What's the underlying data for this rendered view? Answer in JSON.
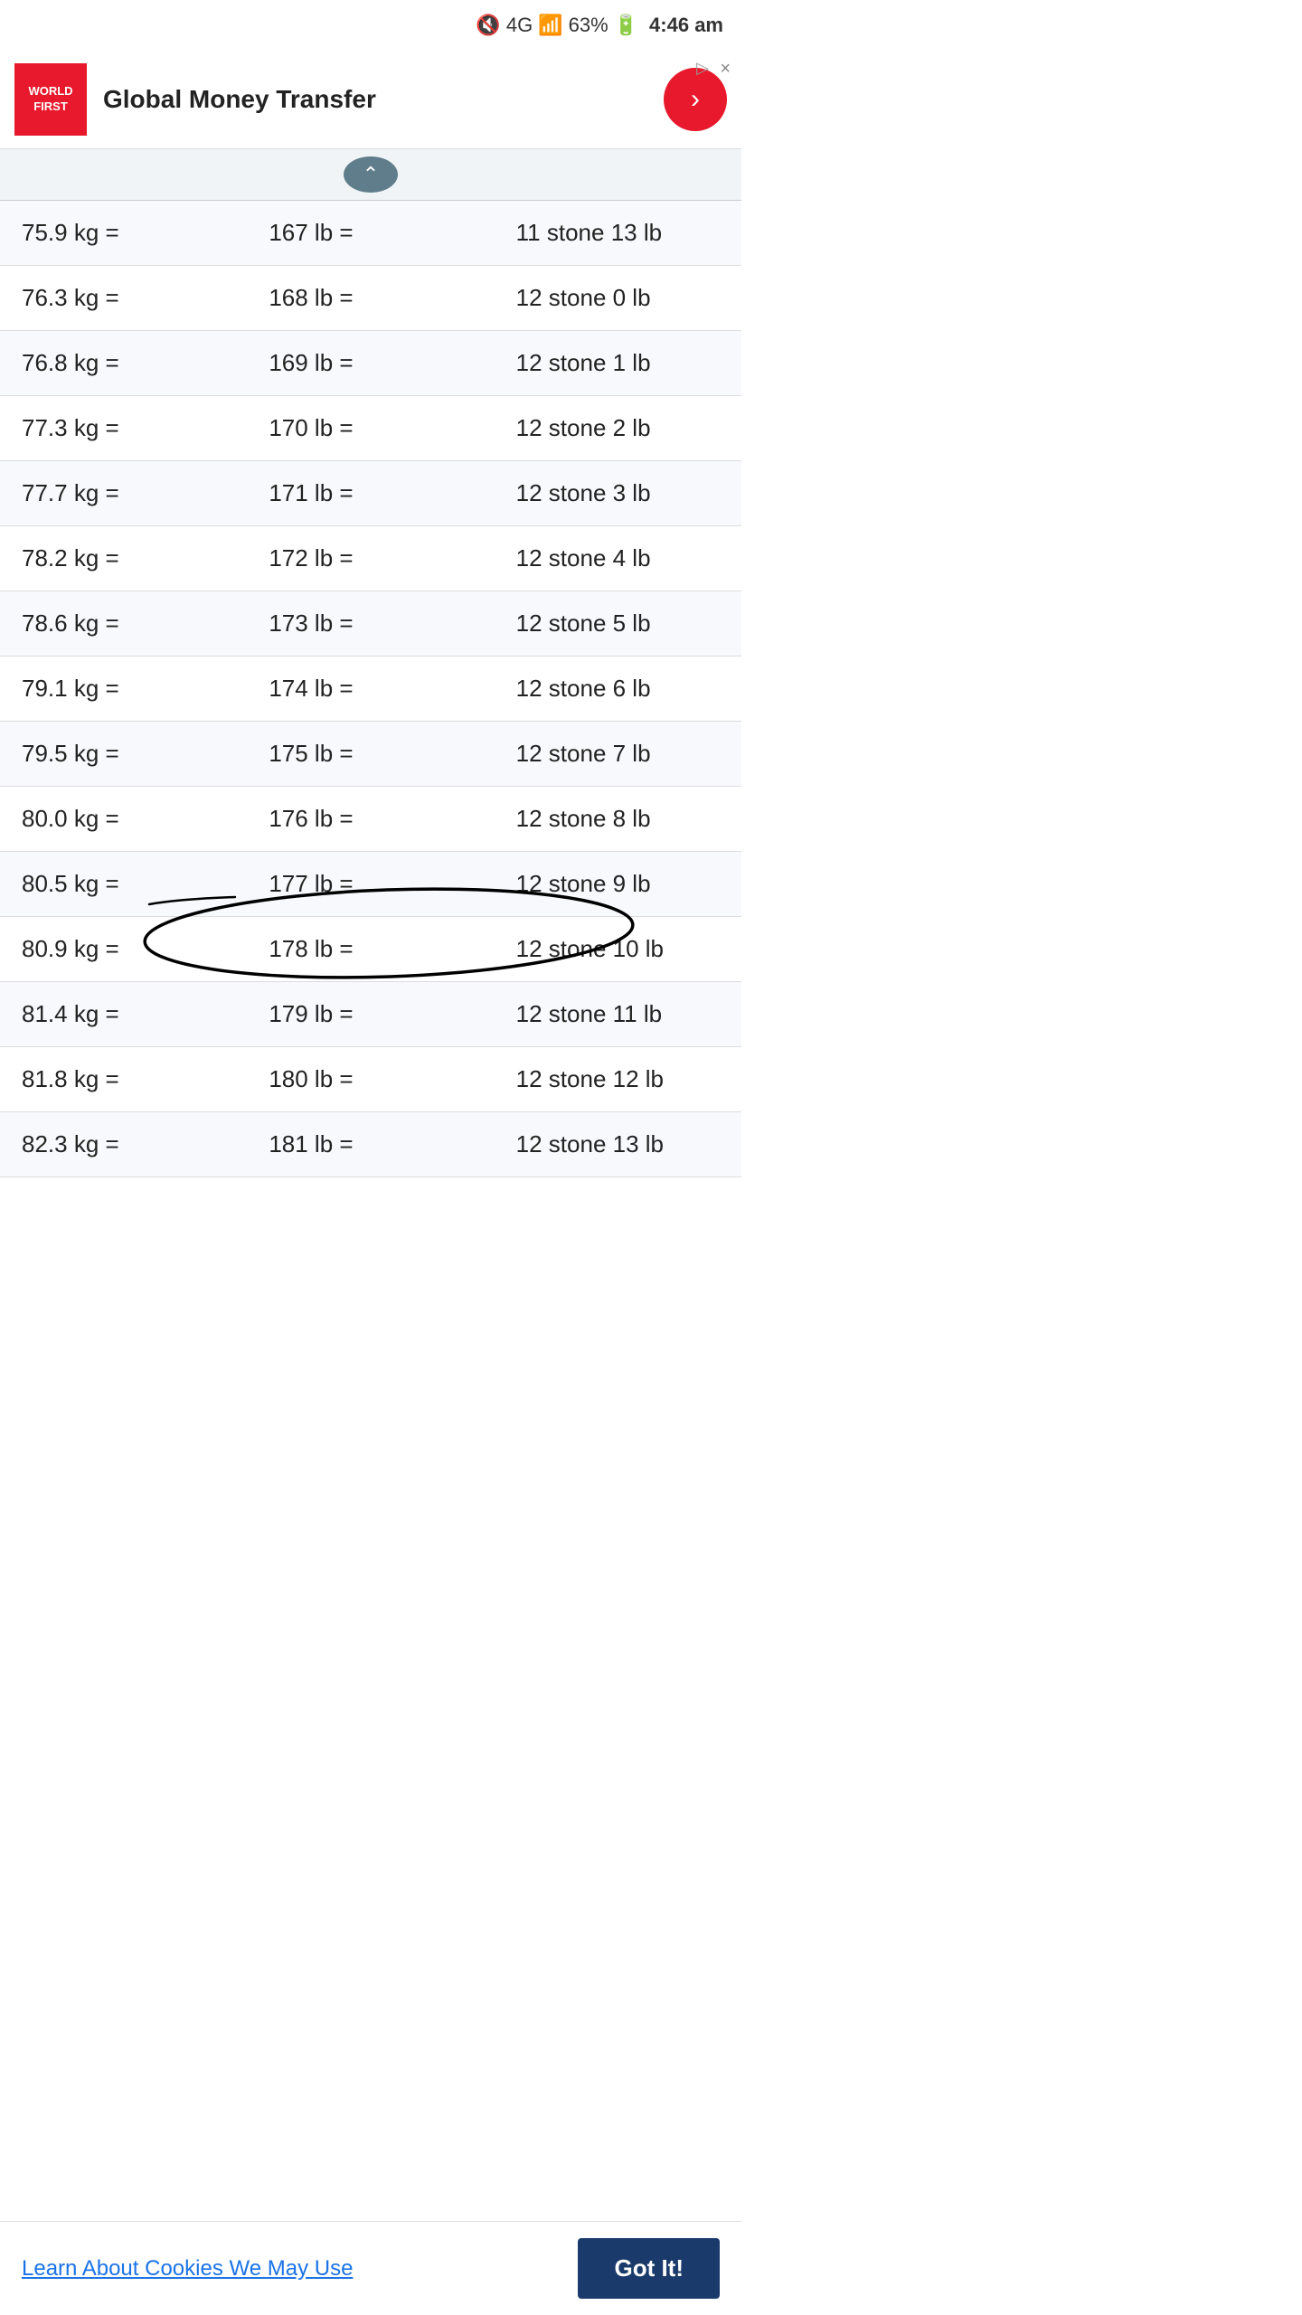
{
  "statusBar": {
    "battery": "63%",
    "time": "4:46 am",
    "signal": "4G"
  },
  "ad": {
    "logoLine1": "WORLD",
    "logoLine2": "FIRST",
    "text": "Global Money Transfer",
    "closeLabel": "×",
    "infoLabel": "▷"
  },
  "scrollUp": {
    "label": "∧"
  },
  "table": {
    "rows": [
      {
        "kg": "75.9 kg =",
        "lb": "167 lb =",
        "stone": "11 stone 13 lb"
      },
      {
        "kg": "76.3 kg =",
        "lb": "168 lb =",
        "stone": "12 stone 0 lb"
      },
      {
        "kg": "76.8 kg =",
        "lb": "169 lb =",
        "stone": "12 stone 1 lb"
      },
      {
        "kg": "77.3 kg =",
        "lb": "170 lb =",
        "stone": "12 stone 2 lb"
      },
      {
        "kg": "77.7 kg =",
        "lb": "171 lb =",
        "stone": "12 stone 3 lb"
      },
      {
        "kg": "78.2 kg =",
        "lb": "172 lb =",
        "stone": "12 stone 4 lb"
      },
      {
        "kg": "78.6 kg =",
        "lb": "173 lb =",
        "stone": "12 stone 5 lb"
      },
      {
        "kg": "79.1 kg =",
        "lb": "174 lb =",
        "stone": "12 stone 6 lb"
      },
      {
        "kg": "79.5 kg =",
        "lb": "175 lb =",
        "stone": "12 stone 7 lb"
      },
      {
        "kg": "80.0 kg =",
        "lb": "176 lb =",
        "stone": "12 stone 8 lb"
      },
      {
        "kg": "80.5 kg =",
        "lb": "177 lb =",
        "stone": "12 stone 9 lb",
        "circled": true
      },
      {
        "kg": "80.9 kg =",
        "lb": "178 lb =",
        "stone": "12 stone 10 lb"
      },
      {
        "kg": "81.4 kg =",
        "lb": "179 lb =",
        "stone": "12 stone 11 lb"
      },
      {
        "kg": "81.8 kg =",
        "lb": "180 lb =",
        "stone": "12 stone 12 lb"
      },
      {
        "kg": "82.3 kg =",
        "lb": "181 lb =",
        "stone": "12 stone 13 lb"
      }
    ]
  },
  "cookieBar": {
    "linkText": "Learn About Cookies We May Use",
    "buttonText": "Got It!"
  }
}
